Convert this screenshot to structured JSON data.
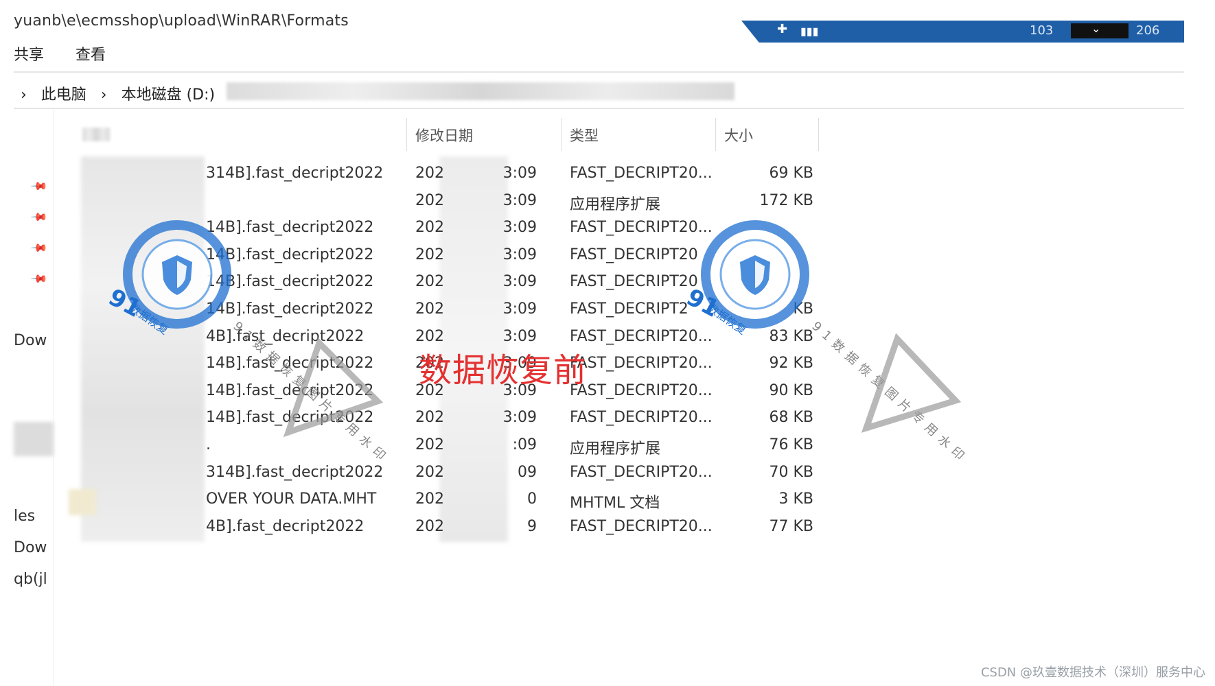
{
  "window": {
    "path": "yuanb\\e\\ecmsshop\\upload\\WinRAR\\Formats",
    "ribbon_tabs": [
      "共享",
      "查看"
    ],
    "taskbar": {
      "left_num": "103",
      "right_num": "206"
    }
  },
  "address_bar": {
    "segments": [
      "此电脑",
      "本地磁盘 (D:)"
    ]
  },
  "columns": {
    "date": "修改日期",
    "type": "类型",
    "size": "大小"
  },
  "files": [
    {
      "name": "314B].fast_decript2022",
      "date_prefix": "202",
      "date_suffix": "3:09",
      "type": "FAST_DECRIPT20...",
      "size": "69 KB"
    },
    {
      "name": "",
      "date_prefix": "202",
      "date_suffix": "3:09",
      "type": "应用程序扩展",
      "size": "172 KB"
    },
    {
      "name": "14B].fast_decript2022",
      "date_prefix": "202",
      "date_suffix": "3:09",
      "type": "FAST_DECRIPT20...",
      "size": ""
    },
    {
      "name": "14B].fast_decript2022",
      "date_prefix": "202",
      "date_suffix": "3:09",
      "type": "FAST_DECRIPT20",
      "size": ""
    },
    {
      "name": "14B].fast_decript2022",
      "date_prefix": "202",
      "date_suffix": "3:09",
      "type": "FAST_DECRIPT20",
      "size": ""
    },
    {
      "name": "14B].fast_decript2022",
      "date_prefix": "202",
      "date_suffix": "3:09",
      "type": "FAST_DECRIPT2",
      "size": "KB"
    },
    {
      "name": "4B].fast_decript2022",
      "date_prefix": "202",
      "date_suffix": "3:09",
      "type": "FAST_DECRIPT20...",
      "size": "83 KB"
    },
    {
      "name": "14B].fast_decript2022",
      "date_prefix": "202",
      "date_suffix": "3:09",
      "type": "FAST_DECRIPT20...",
      "size": "92 KB"
    },
    {
      "name": "14B].fast_decript2022",
      "date_prefix": "202",
      "date_suffix": "3:09",
      "type": "FAST_DECRIPT20...",
      "size": "90 KB"
    },
    {
      "name": "14B].fast_decript2022",
      "date_prefix": "202",
      "date_suffix": "3:09",
      "type": "FAST_DECRIPT20...",
      "size": "68 KB"
    },
    {
      "name": ".",
      "date_prefix": "202",
      "date_suffix": ":09",
      "type": "应用程序扩展",
      "size": "76 KB"
    },
    {
      "name": "314B].fast_decript2022",
      "date_prefix": "202",
      "date_suffix": "09",
      "type": "FAST_DECRIPT20...",
      "size": "70 KB"
    },
    {
      "name": "OVER YOUR DATA.MHT",
      "date_prefix": "202",
      "date_suffix": "0",
      "type": "MHTML 文档",
      "size": "3 KB"
    },
    {
      "name": "4B].fast_decript2022",
      "date_prefix": "202",
      "date_suffix": "9",
      "type": "FAST_DECRIPT20...",
      "size": "77 KB"
    }
  ],
  "sidebar": {
    "items": [
      "Dow",
      "les",
      "Dow",
      "qb(jl"
    ]
  },
  "overlay": {
    "label": "数据恢复前",
    "label_color": "#e53030"
  },
  "watermark": {
    "brand_number": "91",
    "brand_text": "数据恢复",
    "diagonal_text": "91数据恢复图片专用水印"
  },
  "footer": {
    "credit": "CSDN @玖壹数据技术（深圳）服务中心"
  },
  "colors": {
    "taskbar": "#1f5fa8",
    "watermark_blue": "#1e6fd0"
  }
}
